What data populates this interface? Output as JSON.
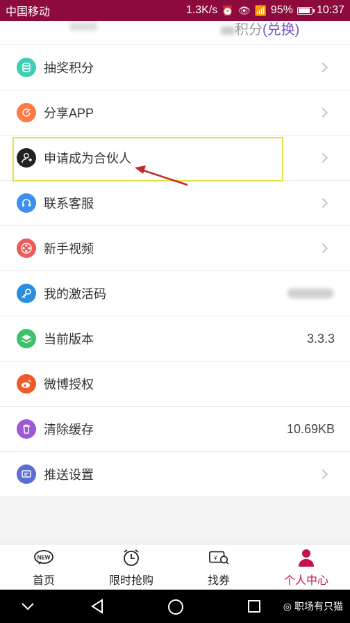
{
  "status_bar": {
    "carrier": "中国移动",
    "speed": "1.3K/s",
    "battery": "95%",
    "time": "10:37"
  },
  "header": {
    "points_partial": "积分",
    "exchange_label": "(兑换)"
  },
  "menu": [
    {
      "label": "抽奖积分",
      "icon": "lottery-icon",
      "color": "#3ccfb4",
      "value": ""
    },
    {
      "label": "分享APP",
      "icon": "share-icon",
      "color": "#ff7a45",
      "value": ""
    },
    {
      "label": "申请成为合伙人",
      "icon": "partner-icon",
      "color": "#222222",
      "value": ""
    },
    {
      "label": "联系客服",
      "icon": "headset-icon",
      "color": "#3a8ff0",
      "value": ""
    },
    {
      "label": "新手视频",
      "icon": "film-reel-icon",
      "color": "#f05a5a",
      "value": ""
    },
    {
      "label": "我的激活码",
      "icon": "key-icon",
      "color": "#2a8fe0",
      "value": ""
    },
    {
      "label": "当前版本",
      "icon": "layers-icon",
      "color": "#3cc26a",
      "value": "3.3.3"
    },
    {
      "label": "微博授权",
      "icon": "weibo-icon",
      "color": "#f05a28",
      "value": ""
    },
    {
      "label": "清除缓存",
      "icon": "trash-icon",
      "color": "#9b59d6",
      "value": "10.69KB"
    },
    {
      "label": "推送设置",
      "icon": "message-icon",
      "color": "#5a6fd6",
      "value": ""
    }
  ],
  "tabs": [
    {
      "label": "首页",
      "icon": "new-badge-icon"
    },
    {
      "label": "限时抢购",
      "icon": "alarm-clock-icon"
    },
    {
      "label": "找券",
      "icon": "coupon-search-icon"
    },
    {
      "label": "个人中心",
      "icon": "person-icon"
    }
  ],
  "watermark": "职场有只猫",
  "colors": {
    "accent": "#c2134f",
    "status_bar": "#8c0a3c",
    "highlight_box": "#e8e03a",
    "arrow": "#c0282d"
  }
}
